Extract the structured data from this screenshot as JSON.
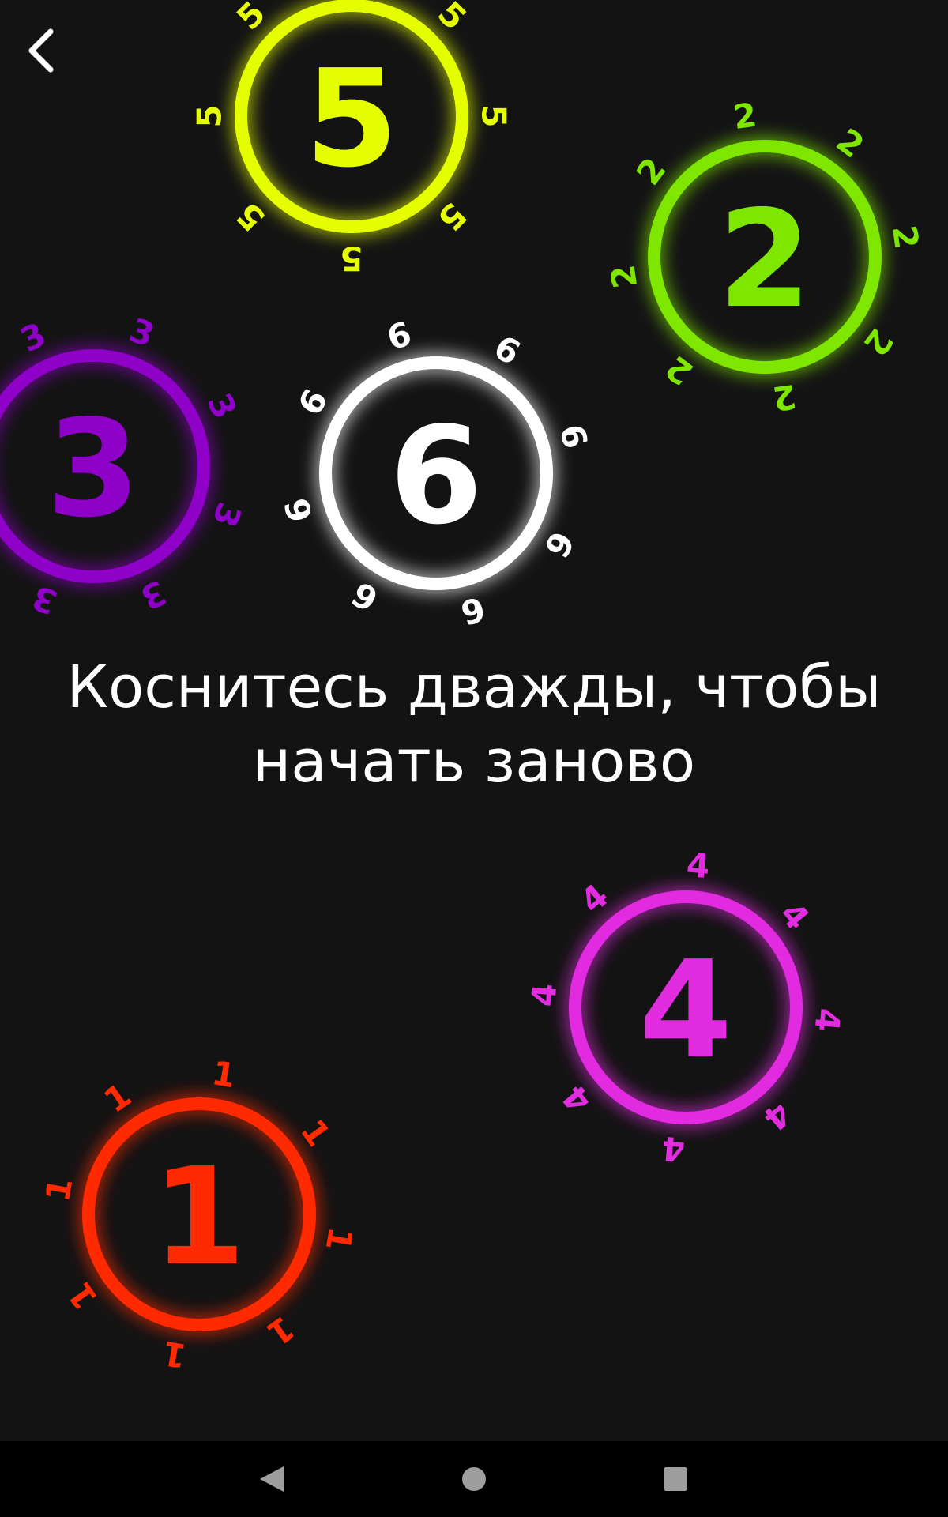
{
  "instruction": {
    "line1": "Коснитесь дважды, чтобы",
    "line2": "начать заново"
  },
  "icons": {
    "back": "chevron-left-icon",
    "nav_back": "triangle-back-icon",
    "nav_home": "circle-home-icon",
    "nav_recents": "square-recents-icon"
  },
  "colors": {
    "background": "#131313",
    "nav_bar": "#000000",
    "nav_icons": "#9e9e9e",
    "text": "#ffffff"
  },
  "touch_circles": [
    {
      "number": "5",
      "color": "#e6ff00",
      "satellite": "5"
    },
    {
      "number": "2",
      "color": "#7fe600",
      "satellite": "2"
    },
    {
      "number": "3",
      "color": "#8f00c8",
      "satellite": "3"
    },
    {
      "number": "6",
      "color": "#ffffff",
      "satellite": "6"
    },
    {
      "number": "4",
      "color": "#e22ce0",
      "satellite": "4"
    },
    {
      "number": "1",
      "color": "#ff2a00",
      "satellite": "1"
    }
  ]
}
